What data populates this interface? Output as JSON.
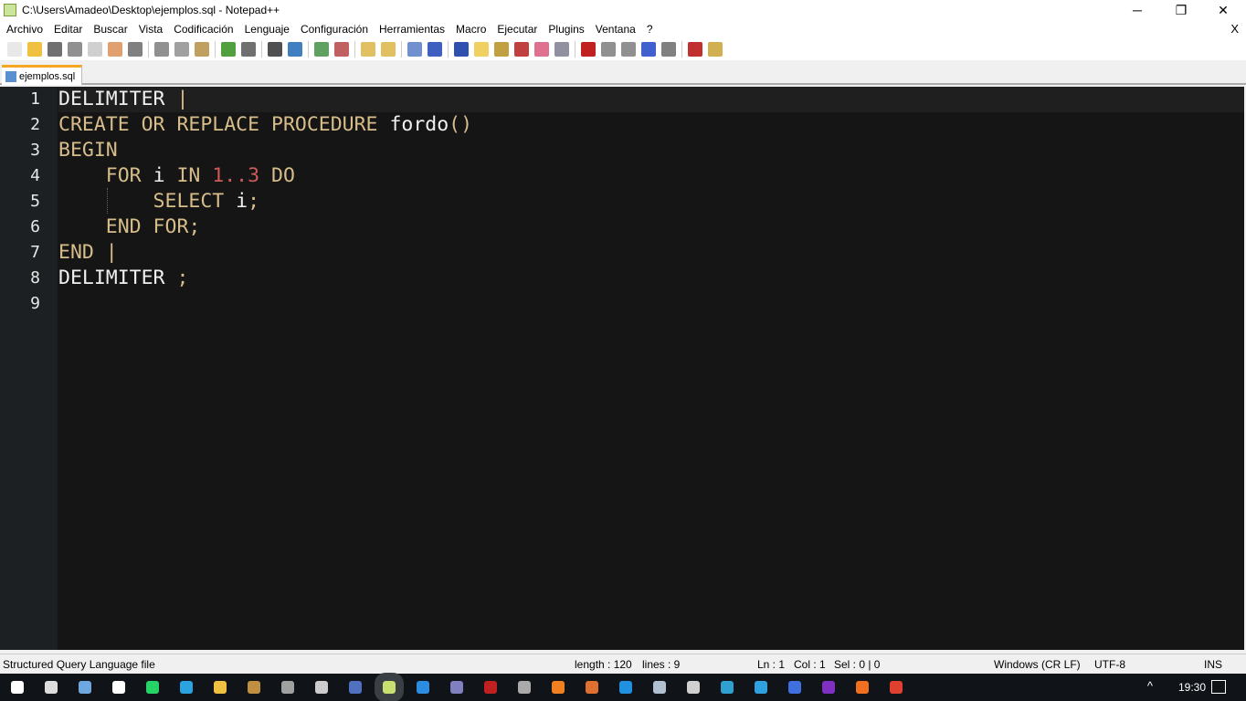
{
  "window": {
    "title": "C:\\Users\\Amadeo\\Desktop\\ejemplos.sql - Notepad++",
    "minimize": "─",
    "restore": "❐",
    "close": "✕"
  },
  "menu": [
    "Archivo",
    "Editar",
    "Buscar",
    "Vista",
    "Codificación",
    "Lenguaje",
    "Configuración",
    "Herramientas",
    "Macro",
    "Ejecutar",
    "Plugins",
    "Ventana",
    "?"
  ],
  "menu_close": "X",
  "toolbar": [
    {
      "name": "new-file",
      "color": "#e8e8e8"
    },
    {
      "name": "open-file",
      "color": "#f0c040"
    },
    {
      "name": "save",
      "color": "#707070"
    },
    {
      "name": "save-all",
      "color": "#909090"
    },
    {
      "name": "close",
      "color": "#d0d0d0"
    },
    {
      "name": "close-all",
      "color": "#e0a070"
    },
    {
      "name": "print",
      "color": "#808080"
    },
    "sep",
    {
      "name": "cut",
      "color": "#909090"
    },
    {
      "name": "copy",
      "color": "#a0a0a0"
    },
    {
      "name": "paste",
      "color": "#c0a060"
    },
    "sep",
    {
      "name": "undo",
      "color": "#50a040"
    },
    {
      "name": "redo",
      "color": "#707070"
    },
    "sep",
    {
      "name": "find",
      "color": "#505050"
    },
    {
      "name": "replace",
      "color": "#4080c0"
    },
    "sep",
    {
      "name": "zoom-in",
      "color": "#60a060"
    },
    {
      "name": "zoom-out",
      "color": "#c06060"
    },
    "sep",
    {
      "name": "sync-vertical",
      "color": "#e0c060"
    },
    {
      "name": "sync-horizontal",
      "color": "#e0c060"
    },
    "sep",
    {
      "name": "word-wrap",
      "color": "#7090d0"
    },
    {
      "name": "show-all-chars",
      "color": "#4060c0"
    },
    "sep",
    {
      "name": "indent-guide",
      "color": "#3050b0"
    },
    {
      "name": "udl",
      "color": "#f0d060"
    },
    {
      "name": "doc-map",
      "color": "#c0a040"
    },
    {
      "name": "function-list",
      "color": "#c04040"
    },
    {
      "name": "folder-as-workspace",
      "color": "#e07090"
    },
    {
      "name": "monitoring",
      "color": "#9090a0"
    },
    "sep",
    {
      "name": "record-macro",
      "color": "#c02020"
    },
    {
      "name": "stop-recording",
      "color": "#909090"
    },
    {
      "name": "playback-macro",
      "color": "#909090"
    },
    {
      "name": "run-macro-multiple",
      "color": "#4060d0"
    },
    {
      "name": "save-macro",
      "color": "#808080"
    },
    "sep",
    {
      "name": "spell-check",
      "color": "#c03030"
    },
    {
      "name": "spell-options",
      "color": "#d0b050"
    }
  ],
  "tab": {
    "label": "ejemplos.sql"
  },
  "editor": {
    "lines": [
      [
        {
          "t": "DELIMITER ",
          "c": ""
        },
        {
          "t": "|",
          "c": "op"
        }
      ],
      [
        {
          "t": "CREATE OR REPLACE PROCEDURE ",
          "c": "kw"
        },
        {
          "t": "fordo",
          "c": ""
        },
        {
          "t": "()",
          "c": "op"
        }
      ],
      [
        {
          "t": "BEGIN",
          "c": "kw"
        }
      ],
      [
        {
          "t": "    FOR ",
          "c": "kw"
        },
        {
          "t": "i ",
          "c": ""
        },
        {
          "t": "IN ",
          "c": "kw"
        },
        {
          "t": "1..3 ",
          "c": "num"
        },
        {
          "t": "DO",
          "c": "kw"
        }
      ],
      [
        {
          "t": "        SELECT ",
          "c": "kw"
        },
        {
          "t": "i",
          "c": ""
        },
        {
          "t": ";",
          "c": "op"
        }
      ],
      [
        {
          "t": "    END FOR;",
          "c": "kw"
        }
      ],
      [
        {
          "t": "END ",
          "c": "kw"
        },
        {
          "t": "|",
          "c": "op"
        }
      ],
      [
        {
          "t": "DELIMITER ",
          "c": ""
        },
        {
          "t": ";",
          "c": "op"
        }
      ],
      []
    ]
  },
  "status": {
    "file_type": "Structured Query Language file",
    "length": "length : 120",
    "lines": "lines : 9",
    "ln": "Ln : 1",
    "col": "Col : 1",
    "sel": "Sel : 0 | 0",
    "eol": "Windows (CR LF)",
    "encoding": "UTF-8",
    "mode": "INS"
  },
  "taskbar": {
    "apps": [
      {
        "name": "start",
        "color": "#ffffff"
      },
      {
        "name": "task-view",
        "color": "#dddddd"
      },
      {
        "name": "keyboard",
        "color": "#6fa8e0"
      },
      {
        "name": "app",
        "color": "#ffffff"
      },
      {
        "name": "whatsapp",
        "color": "#25d366"
      },
      {
        "name": "telegram",
        "color": "#2aa3e0"
      },
      {
        "name": "file-explorer",
        "color": "#f0c040"
      },
      {
        "name": "library",
        "color": "#c09040"
      },
      {
        "name": "terminal",
        "color": "#a0a0a0"
      },
      {
        "name": "game",
        "color": "#cccccc"
      },
      {
        "name": "document-viewer",
        "color": "#5070c0"
      },
      {
        "name": "notepad-plus-plus",
        "color": "#c8e070"
      },
      {
        "name": "vscode",
        "color": "#2b8ce0"
      },
      {
        "name": "menu-app",
        "color": "#8080c0"
      },
      {
        "name": "filezilla",
        "color": "#c02020"
      },
      {
        "name": "clock-app",
        "color": "#aaaaaa"
      },
      {
        "name": "vlc",
        "color": "#f08020"
      },
      {
        "name": "xampp",
        "color": "#e07030"
      },
      {
        "name": "media-player",
        "color": "#2090e0"
      },
      {
        "name": "network-app",
        "color": "#b0c0d0"
      },
      {
        "name": "virtualbox",
        "color": "#d0d0d0"
      },
      {
        "name": "edge",
        "color": "#30a0d0"
      },
      {
        "name": "internet-explorer",
        "color": "#30a0e0"
      },
      {
        "name": "browser",
        "color": "#4070e0"
      },
      {
        "name": "tor",
        "color": "#8030c0"
      },
      {
        "name": "firefox",
        "color": "#f07020"
      },
      {
        "name": "chrome",
        "color": "#e04030"
      }
    ],
    "tray": "^",
    "time": "19:30"
  }
}
